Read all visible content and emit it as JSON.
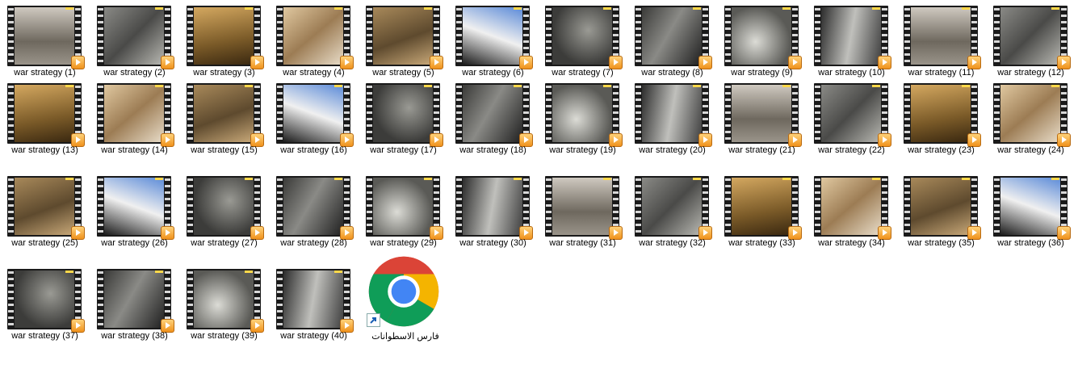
{
  "desktop": {
    "files": [
      {
        "label": "war strategy (1)"
      },
      {
        "label": "war strategy (2)"
      },
      {
        "label": "war strategy (3)"
      },
      {
        "label": "war strategy (4)"
      },
      {
        "label": "war strategy (5)"
      },
      {
        "label": "war strategy (6)"
      },
      {
        "label": "war strategy (7)"
      },
      {
        "label": "war strategy (8)"
      },
      {
        "label": "war strategy (9)"
      },
      {
        "label": "war strategy (10)"
      },
      {
        "label": "war strategy (11)"
      },
      {
        "label": "war strategy (12)"
      },
      {
        "label": "war strategy (13)"
      },
      {
        "label": "war strategy (14)"
      },
      {
        "label": "war strategy (15)"
      },
      {
        "label": "war strategy (16)"
      },
      {
        "label": "war strategy (17)"
      },
      {
        "label": "war strategy (18)"
      },
      {
        "label": "war strategy (19)"
      },
      {
        "label": "war strategy (20)"
      },
      {
        "label": "war strategy (21)"
      },
      {
        "label": "war strategy (22)"
      },
      {
        "label": "war strategy (23)"
      },
      {
        "label": "war strategy (24)"
      },
      {
        "label": "war strategy (25)"
      },
      {
        "label": "war strategy (26)"
      },
      {
        "label": "war strategy (27)"
      },
      {
        "label": "war strategy (28)"
      },
      {
        "label": "war strategy (29)"
      },
      {
        "label": "war strategy (30)"
      },
      {
        "label": "war strategy (31)"
      },
      {
        "label": "war strategy (32)"
      },
      {
        "label": "war strategy (33)"
      },
      {
        "label": "war strategy (34)"
      },
      {
        "label": "war strategy (35)"
      },
      {
        "label": "war strategy (36)"
      },
      {
        "label": "war strategy (37)"
      },
      {
        "label": "war strategy (38)"
      },
      {
        "label": "war strategy (39)"
      },
      {
        "label": "war strategy (40)"
      }
    ],
    "file_icon": "video-file-icon",
    "shortcut": {
      "label": "فارس الاسطوانات",
      "icon": "chrome-icon",
      "overlay_icon": "shortcut-arrow-icon"
    }
  }
}
